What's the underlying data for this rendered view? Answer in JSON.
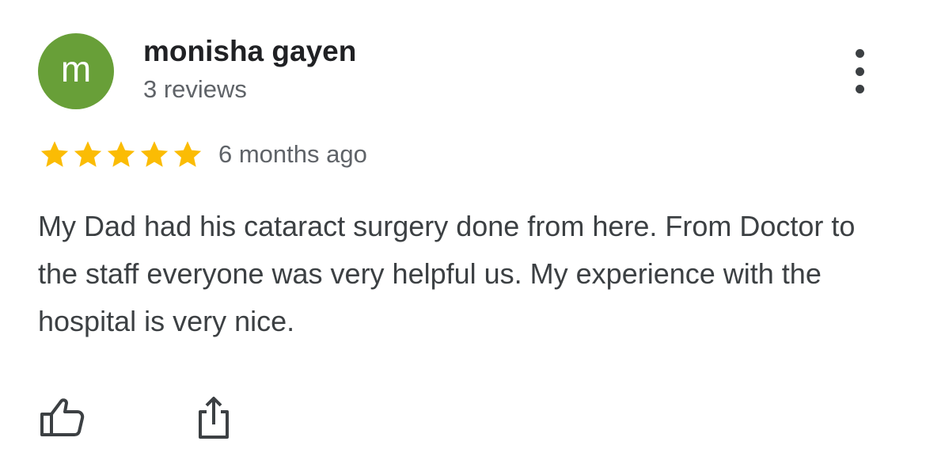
{
  "review": {
    "avatar_initial": "m",
    "reviewer_name": "monisha gayen",
    "review_count": "3 reviews",
    "rating": 5,
    "rating_max": 5,
    "date": "6 months ago",
    "text": "My Dad had his cataract surgery done from here. From Doctor to the staff everyone was very helpful us. My experience with the hospital is very nice."
  },
  "icons": {
    "more": "more-vert-icon",
    "star": "star-icon",
    "like": "thumb-up-icon",
    "share": "share-icon"
  },
  "colors": {
    "avatar_bg": "#689f38",
    "star": "#fbbc04",
    "name": "#202124",
    "secondary": "#5f6368",
    "text": "#3c4043"
  }
}
